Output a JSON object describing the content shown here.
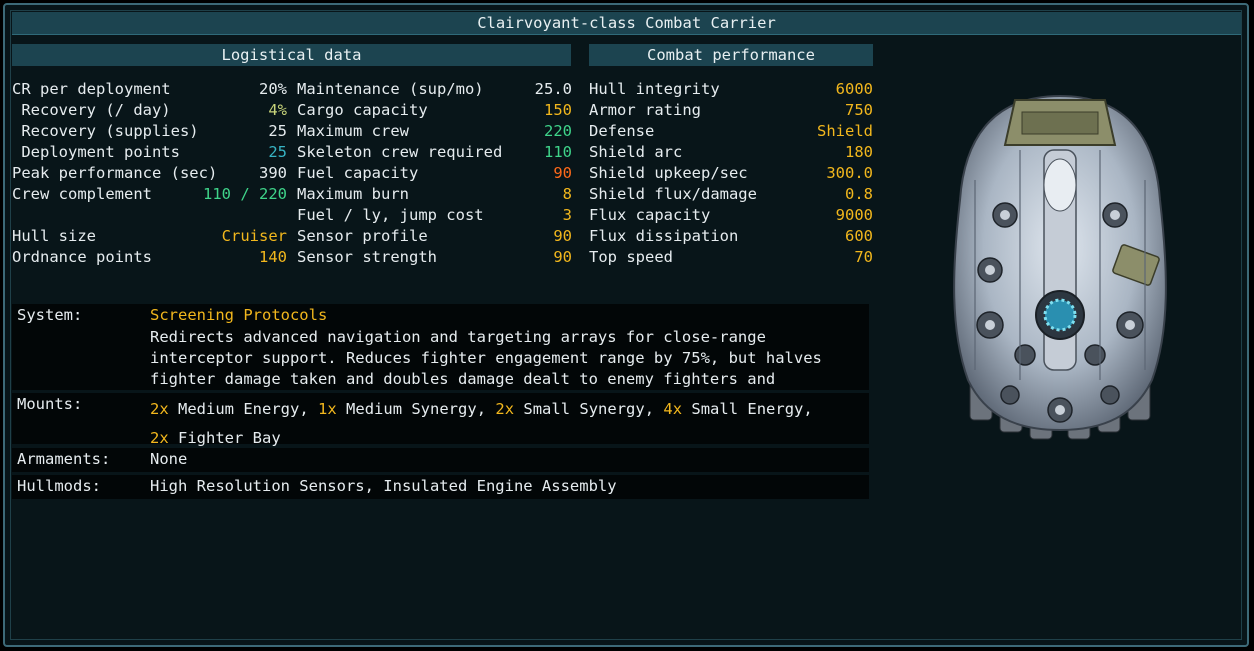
{
  "title": "Clairvoyant-class Combat Carrier",
  "headers": {
    "logistical": "Logistical data",
    "combat": "Combat performance"
  },
  "col1": [
    {
      "label": "CR per deployment",
      "value": "20%",
      "color": "w"
    },
    {
      "label": " Recovery (/ day)",
      "value": "4%",
      "color": "gy"
    },
    {
      "label": " Recovery (supplies)",
      "value": "25",
      "color": "w"
    },
    {
      "label": " Deployment points",
      "value": "25",
      "color": "c"
    },
    {
      "label": "Peak performance (sec)",
      "value": "390",
      "color": "w"
    },
    {
      "label": "Crew complement",
      "value": "110 / 220",
      "color": "g"
    },
    {
      "label": "",
      "value": "",
      "color": "w"
    },
    {
      "label": "Hull size",
      "value": "Cruiser",
      "color": "y"
    },
    {
      "label": "Ordnance points",
      "value": "140",
      "color": "y"
    }
  ],
  "col2": [
    {
      "label": "Maintenance (sup/mo)",
      "value": "25.0",
      "color": "w"
    },
    {
      "label": "Cargo capacity",
      "value": "150",
      "color": "y"
    },
    {
      "label": "Maximum crew",
      "value": "220",
      "color": "g"
    },
    {
      "label": "Skeleton crew required",
      "value": "110",
      "color": "g"
    },
    {
      "label": "Fuel capacity",
      "value": "90",
      "color": "r"
    },
    {
      "label": "Maximum burn",
      "value": "8",
      "color": "y"
    },
    {
      "label": "Fuel / ly, jump cost",
      "value": "3",
      "color": "y"
    },
    {
      "label": "Sensor profile",
      "value": "90",
      "color": "y"
    },
    {
      "label": "Sensor strength",
      "value": "90",
      "color": "y"
    }
  ],
  "col3": [
    {
      "label": "Hull integrity",
      "value": "6000",
      "color": "y"
    },
    {
      "label": "Armor rating",
      "value": "750",
      "color": "y"
    },
    {
      "label": "Defense",
      "value": "Shield",
      "color": "y"
    },
    {
      "label": "Shield arc",
      "value": "180",
      "color": "y"
    },
    {
      "label": "Shield upkeep/sec",
      "value": "300.0",
      "color": "y"
    },
    {
      "label": "Shield flux/damage",
      "value": "0.8",
      "color": "y"
    },
    {
      "label": "Flux capacity",
      "value": "9000",
      "color": "y"
    },
    {
      "label": "Flux dissipation",
      "value": "600",
      "color": "y"
    },
    {
      "label": "Top speed",
      "value": "70",
      "color": "y"
    }
  ],
  "system": {
    "label": "System:",
    "name": "Screening Protocols",
    "desc": "Redirects advanced navigation and targeting arrays for close-range interceptor support. Reduces fighter engagement range by 75%, but halves fighter damage taken and doubles damage dealt to enemy fighters and missiles."
  },
  "mounts": {
    "label": "Mounts:",
    "items": [
      {
        "count": "2x",
        "name": "Medium Energy"
      },
      {
        "count": "1x",
        "name": "Medium Synergy"
      },
      {
        "count": "2x",
        "name": "Small Synergy"
      },
      {
        "count": "4x",
        "name": "Small Energy"
      },
      {
        "count": "2x",
        "name": "Fighter Bay"
      }
    ]
  },
  "armaments": {
    "label": "Armaments:",
    "value": "None"
  },
  "hullmods": {
    "label": "Hullmods:",
    "value": "High Resolution Sensors, Insulated Engine Assembly"
  },
  "colors": {
    "highlight": "#f2b71d",
    "positive": "#3fd48a",
    "cyan": "#37b4c4",
    "warning": "#ff6a1a",
    "header_bg": "#1c4450"
  }
}
